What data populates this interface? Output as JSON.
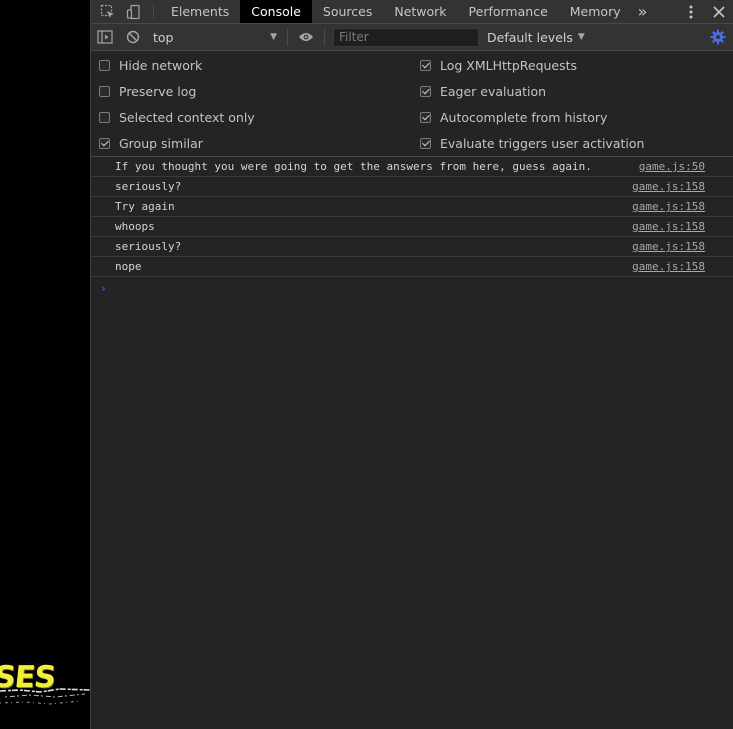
{
  "page": {
    "game_text": "SES"
  },
  "tabbar": {
    "tabs": [
      {
        "label": "Elements",
        "active": false
      },
      {
        "label": "Console",
        "active": true
      },
      {
        "label": "Sources",
        "active": false
      },
      {
        "label": "Network",
        "active": false
      },
      {
        "label": "Performance",
        "active": false
      },
      {
        "label": "Memory",
        "active": false
      }
    ],
    "overflow_icon": "double-chevron-right",
    "menu_icon": "kebab-menu",
    "close_icon": "close"
  },
  "toolbar": {
    "context": "top",
    "filter_placeholder": "Filter",
    "filter_value": "",
    "levels_label": "Default levels",
    "accent_color": "#4b6ee8"
  },
  "settings": {
    "left": [
      {
        "label": "Hide network",
        "checked": false
      },
      {
        "label": "Preserve log",
        "checked": false
      },
      {
        "label": "Selected context only",
        "checked": false
      },
      {
        "label": "Group similar",
        "checked": true
      }
    ],
    "right": [
      {
        "label": "Log XMLHttpRequests",
        "checked": true
      },
      {
        "label": "Eager evaluation",
        "checked": true
      },
      {
        "label": "Autocomplete from history",
        "checked": true
      },
      {
        "label": "Evaluate triggers user activation",
        "checked": true
      }
    ]
  },
  "messages": [
    {
      "text": "If you thought you were going to get the answers from here, guess again.",
      "source": "game.js:50"
    },
    {
      "text": "seriously?",
      "source": "game.js:158"
    },
    {
      "text": "Try again",
      "source": "game.js:158"
    },
    {
      "text": "whoops",
      "source": "game.js:158"
    },
    {
      "text": "seriously?",
      "source": "game.js:158"
    },
    {
      "text": "nope",
      "source": "game.js:158"
    }
  ],
  "prompt": {
    "symbol": "›"
  }
}
